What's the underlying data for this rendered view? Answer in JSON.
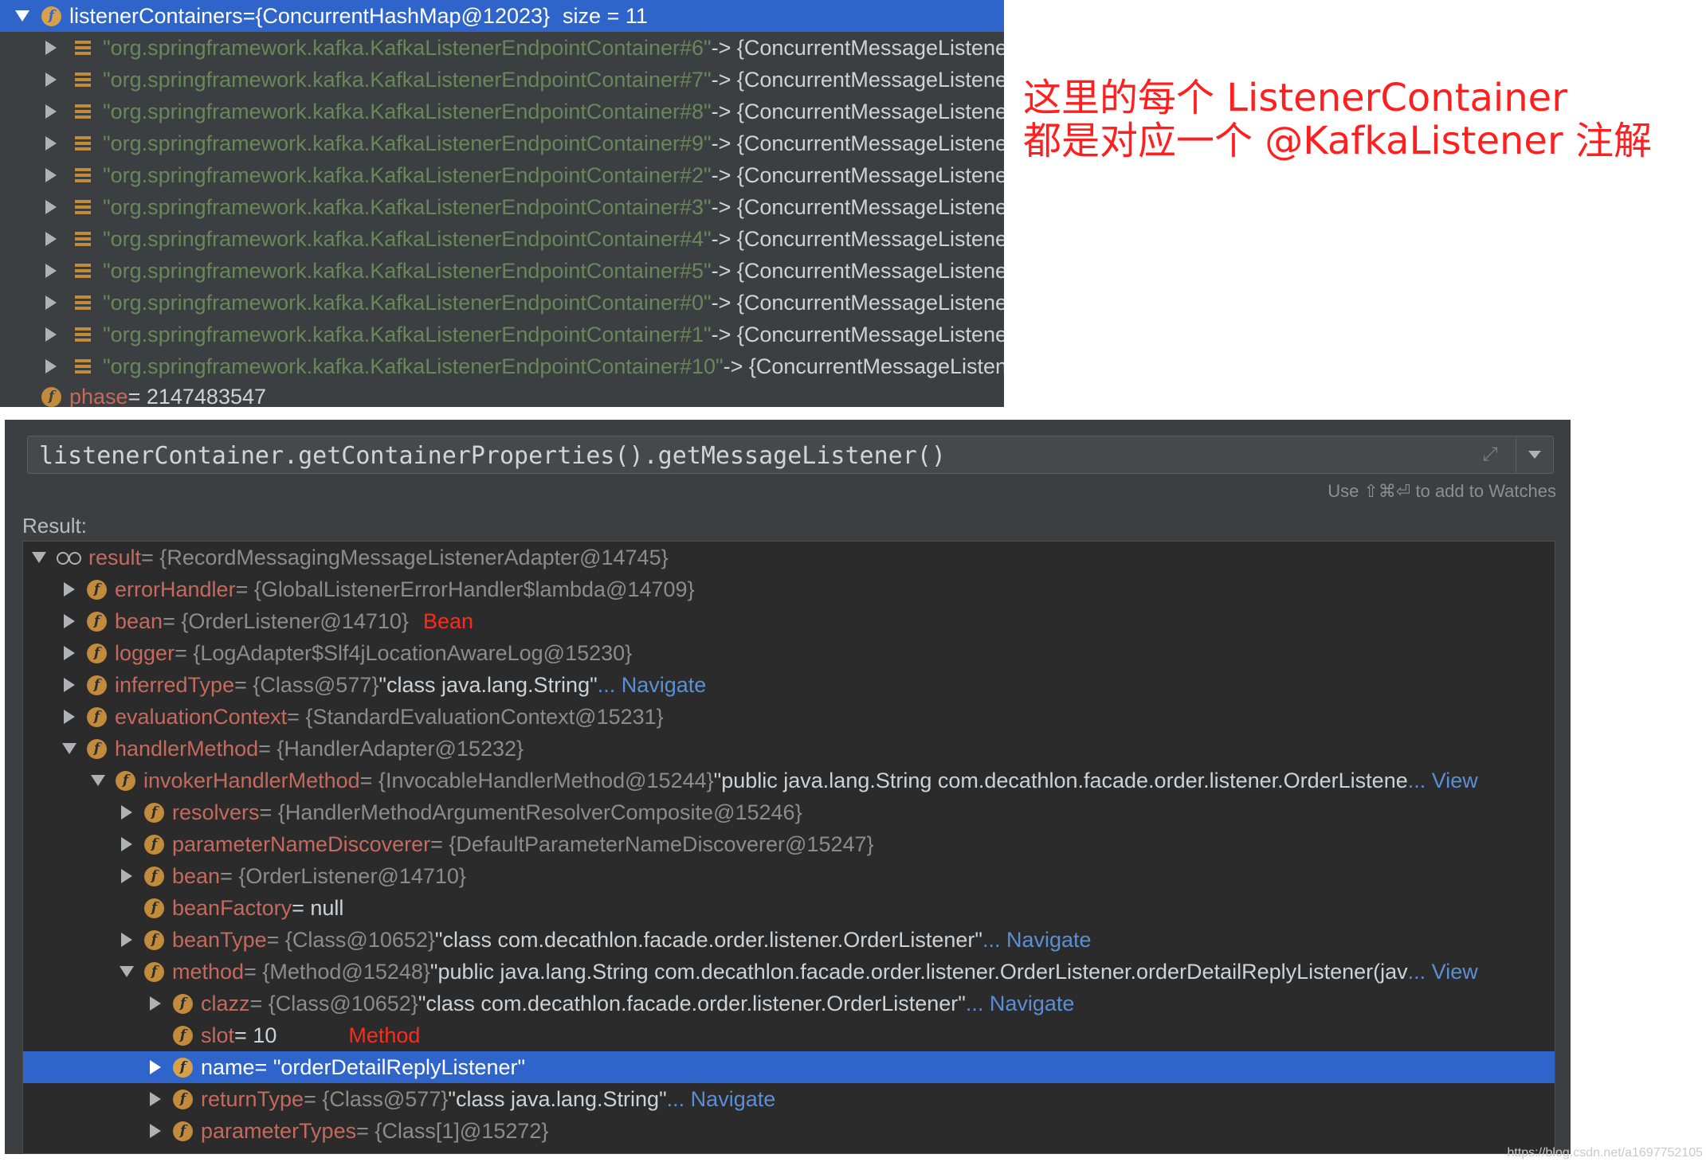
{
  "top_tree": {
    "header": {
      "name": "listenerContainers",
      "eq": " = ",
      "value": "{ConcurrentHashMap@12023}",
      "size": "size = 11"
    },
    "entries": [
      {
        "key": "\"org.springframework.kafka.KafkaListenerEndpointContainer#6\"",
        "value": " -> {ConcurrentMessageListenerContainer@"
      },
      {
        "key": "\"org.springframework.kafka.KafkaListenerEndpointContainer#7\"",
        "value": " -> {ConcurrentMessageListenerContainer@"
      },
      {
        "key": "\"org.springframework.kafka.KafkaListenerEndpointContainer#8\"",
        "value": " -> {ConcurrentMessageListenerContainer@"
      },
      {
        "key": "\"org.springframework.kafka.KafkaListenerEndpointContainer#9\"",
        "value": " -> {ConcurrentMessageListenerContainer@"
      },
      {
        "key": "\"org.springframework.kafka.KafkaListenerEndpointContainer#2\"",
        "value": " -> {ConcurrentMessageListenerContainer@"
      },
      {
        "key": "\"org.springframework.kafka.KafkaListenerEndpointContainer#3\"",
        "value": " -> {ConcurrentMessageListenerContainer@"
      },
      {
        "key": "\"org.springframework.kafka.KafkaListenerEndpointContainer#4\"",
        "value": " -> {ConcurrentMessageListenerContainer@"
      },
      {
        "key": "\"org.springframework.kafka.KafkaListenerEndpointContainer#5\"",
        "value": " -> {ConcurrentMessageListenerContainer@"
      },
      {
        "key": "\"org.springframework.kafka.KafkaListenerEndpointContainer#0\"",
        "value": " -> {ConcurrentMessageListenerContainer@"
      },
      {
        "key": "\"org.springframework.kafka.KafkaListenerEndpointContainer#1\"",
        "value": " -> {ConcurrentMessageListenerContainer@"
      },
      {
        "key": "\"org.springframework.kafka.KafkaListenerEndpointContainer#10\"",
        "value": " -> {ConcurrentMessageListenerContainer@"
      }
    ],
    "phase": {
      "name": "phase",
      "value": " = 2147483547"
    }
  },
  "annotation": {
    "line1": "这里的每个 ListenerContainer",
    "line2": "都是对应一个 @KafkaListener 注解"
  },
  "evaluate": {
    "expression": "listenerContainer.getContainerProperties().getMessageListener()",
    "hint": "Use ⇧⌘⏎ to add to Watches",
    "result_label": "Result:"
  },
  "result_tree": [
    {
      "name": "result",
      "value": " = {RecordMessagingMessageListenerAdapter@14745}",
      "extra": "",
      "link": "",
      "tag": ""
    },
    {
      "name": "errorHandler",
      "value": " = {GlobalListenerErrorHandler$lambda@14709}",
      "extra": "",
      "link": "",
      "tag": ""
    },
    {
      "name": "bean",
      "value": " = {OrderListener@14710}",
      "extra": "",
      "link": "",
      "tag": "Bean"
    },
    {
      "name": "logger",
      "value": " = {LogAdapter$Slf4jLocationAwareLog@15230}",
      "extra": "",
      "link": "",
      "tag": ""
    },
    {
      "name": "inferredType",
      "value": " = {Class@577}",
      "extra": " \"class java.lang.String\"",
      "link": " ... Navigate",
      "tag": ""
    },
    {
      "name": "evaluationContext",
      "value": " = {StandardEvaluationContext@15231}",
      "extra": "",
      "link": "",
      "tag": ""
    },
    {
      "name": "handlerMethod",
      "value": " = {HandlerAdapter@15232}",
      "extra": "",
      "link": "",
      "tag": ""
    },
    {
      "name": "invokerHandlerMethod",
      "value": " = {InvocableHandlerMethod@15244}",
      "extra": " \"public java.lang.String com.decathlon.facade.order.listener.OrderListene",
      "link": "... View",
      "tag": ""
    },
    {
      "name": "resolvers",
      "value": " = {HandlerMethodArgumentResolverComposite@15246}",
      "extra": "",
      "link": "",
      "tag": ""
    },
    {
      "name": "parameterNameDiscoverer",
      "value": " = {DefaultParameterNameDiscoverer@15247}",
      "extra": "",
      "link": "",
      "tag": ""
    },
    {
      "name": "bean",
      "value": " = {OrderListener@14710}",
      "extra": "",
      "link": "",
      "tag": ""
    },
    {
      "name": "beanFactory",
      "value": " = null",
      "extra": "",
      "link": "",
      "tag": ""
    },
    {
      "name": "beanType",
      "value": " = {Class@10652}",
      "extra": " \"class com.decathlon.facade.order.listener.OrderListener\"",
      "link": " ... Navigate",
      "tag": ""
    },
    {
      "name": "method",
      "value": " = {Method@15248}",
      "extra": " \"public java.lang.String com.decathlon.facade.order.listener.OrderListener.orderDetailReplyListener(jav",
      "link": "... View",
      "tag": ""
    },
    {
      "name": "clazz",
      "value": " = {Class@10652}",
      "extra": " \"class com.decathlon.facade.order.listener.OrderListener\"",
      "link": " ... Navigate",
      "tag": ""
    },
    {
      "name": "slot",
      "value": " = 10",
      "extra": "",
      "link": "",
      "tag": "Method"
    },
    {
      "name": "name",
      "value": " = \"orderDetailReplyListener\"",
      "extra": "",
      "link": "",
      "tag": ""
    },
    {
      "name": "returnType",
      "value": " = {Class@577}",
      "extra": " \"class java.lang.String\"",
      "link": " ... Navigate",
      "tag": ""
    },
    {
      "name": "parameterTypes",
      "value": " = {Class[1]@15272}",
      "extra": "",
      "link": "",
      "tag": ""
    }
  ],
  "watermark": "https://blog.csdn.net/a1697752105",
  "colors": {
    "panel_bg": "#3c3f41",
    "tree_bg": "#2b2b2b",
    "selection": "#2f65ca",
    "field_icon": "#c28a3b",
    "string": "#6a8759",
    "field_name": "#c56a5c",
    "link": "#5a8fd6",
    "annotation": "#ff1f1f"
  },
  "icons": {
    "field": "field-f-icon",
    "map_entry": "map-entry-icon",
    "watch": "watch-glasses-icon"
  }
}
